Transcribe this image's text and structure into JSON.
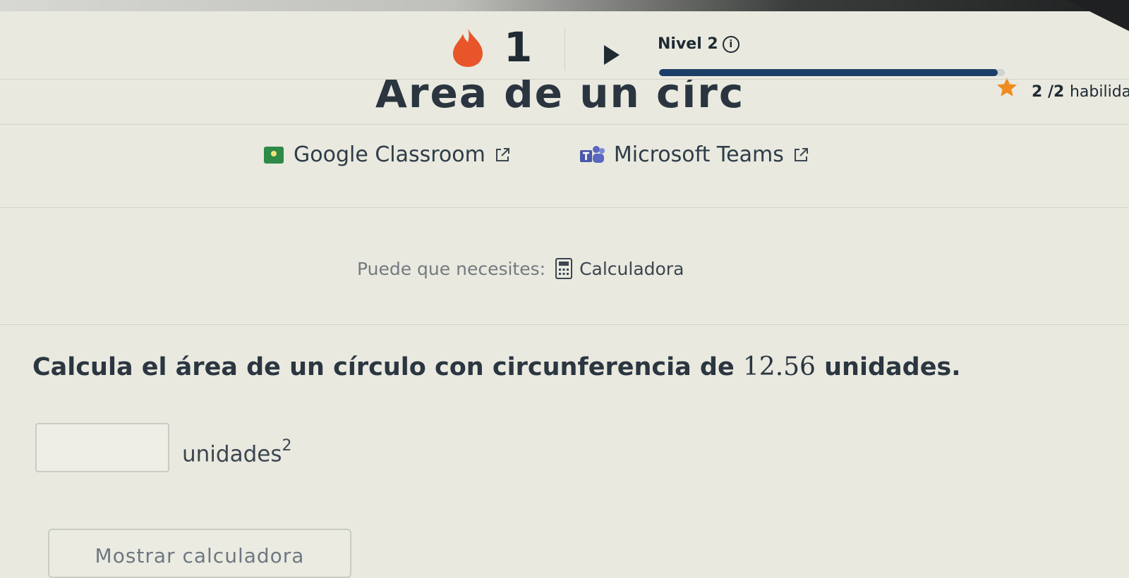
{
  "header": {
    "streak_count": "1",
    "level_label": "Nivel 2",
    "info_glyph": "i",
    "progress_fraction": 0.98,
    "skills_count": "2 /2",
    "skills_suffix": "habilidad"
  },
  "page": {
    "title": "Área de un círculo"
  },
  "share": {
    "google_classroom_label": "Google Classroom",
    "microsoft_teams_label": "Microsoft Teams"
  },
  "tools": {
    "needs_label": "Puede que necesites:",
    "calculator_label": "Calculadora"
  },
  "exercise": {
    "question_prefix": "Calcula el área de un círculo con circunferencia de",
    "question_value": "12.56",
    "question_suffix": "unidades.",
    "answer_value": "",
    "unit_label": "unidades",
    "unit_exponent": "2",
    "show_calculator_label": "Mostrar calculadora"
  },
  "colors": {
    "background": "#e9e9df",
    "accent": "#1b3f69",
    "flame": "#e8552a",
    "star": "#f08c1e"
  },
  "icons": [
    "flame-icon",
    "play-arrow-icon",
    "info-icon",
    "star-icon",
    "google-classroom-icon",
    "microsoft-teams-icon",
    "external-link-icon",
    "calculator-icon"
  ]
}
